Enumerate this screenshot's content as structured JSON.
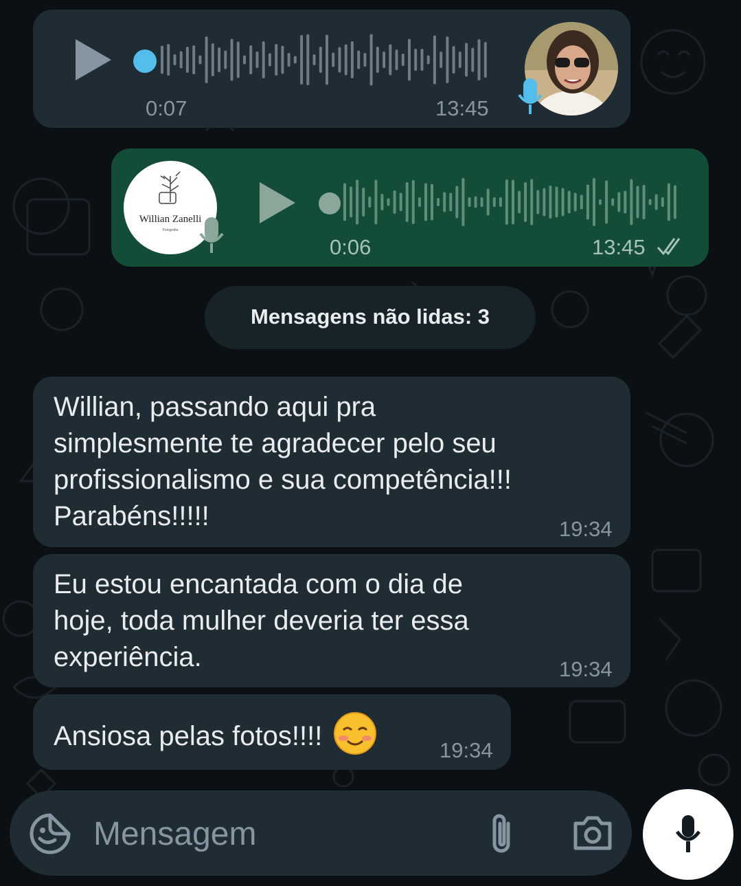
{
  "messages": [
    {
      "kind": "voice",
      "duration": "0:07",
      "time": "13:45"
    },
    {
      "kind": "voice",
      "duration": "0:06",
      "time": "13:45",
      "logo_text": "Willian Zanelli",
      "logo_sub": "Fotografia"
    },
    {
      "kind": "text",
      "lines": [
        "Willian, passando aqui pra",
        "simplesmente te agradecer pelo seu",
        "profissionalismo e sua competência!!!",
        "Parabéns!!!!!"
      ],
      "time": "19:34"
    },
    {
      "kind": "text",
      "lines": [
        "Eu estou encantada com o dia de",
        "hoje, toda mulher deveria ter essa",
        "experiência."
      ],
      "time": "19:34"
    },
    {
      "kind": "text",
      "text": "Ansiosa pelas fotos!!!!",
      "emoji": "☺️",
      "time": "19:34"
    }
  ],
  "unread_label": "Mensagens não lidas: 3",
  "composer": {
    "placeholder": "Mensagem"
  },
  "icons": {
    "sticker": "sticker-icon",
    "attach": "paperclip-icon",
    "camera": "camera-icon",
    "mic": "mic-icon"
  },
  "colors": {
    "incoming": "#202c33",
    "outgoing": "#144d37",
    "accent": "#53bdeb",
    "background": "#0b1014"
  }
}
